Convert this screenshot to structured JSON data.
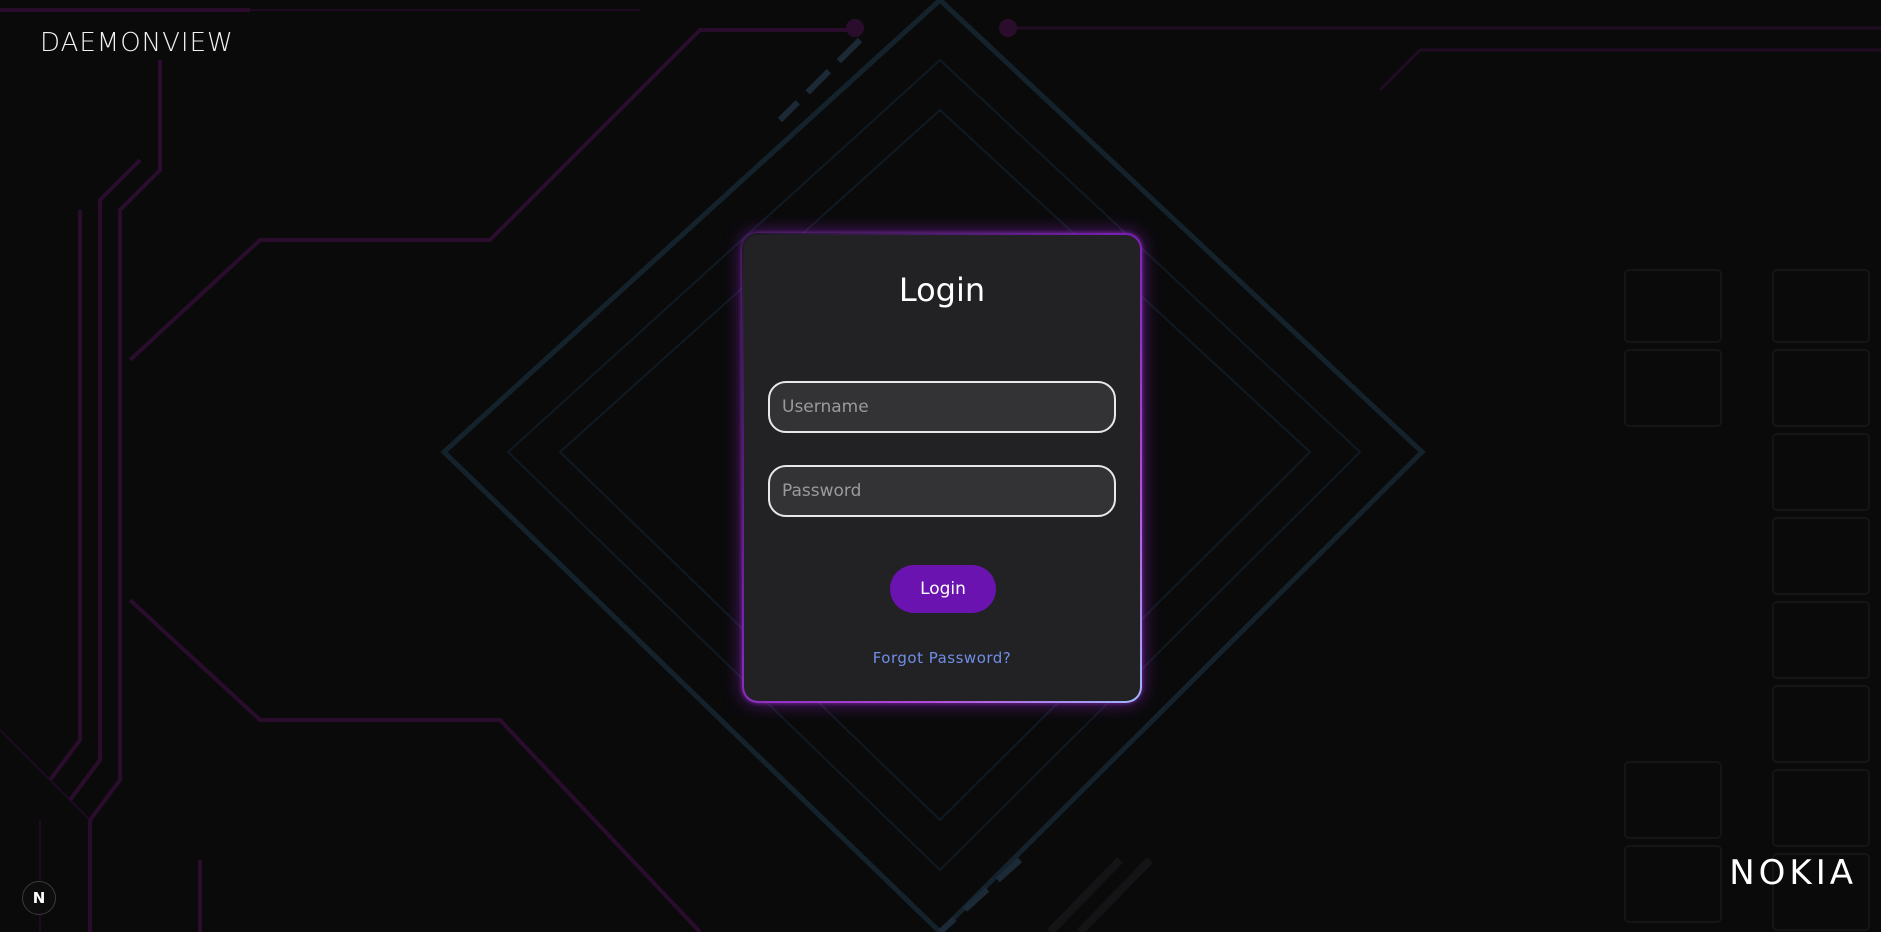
{
  "header": {
    "brand": "DAEMONVIEW"
  },
  "login": {
    "title": "Login",
    "username_placeholder": "Username",
    "password_placeholder": "Password",
    "submit_label": "Login",
    "forgot_label": "Forgot Password?"
  },
  "footer": {
    "vendor_logo": "NOKIA",
    "framework_badge": "N"
  },
  "theme": {
    "background": "#0a0a0b",
    "card": "#222224",
    "accent": "#6a13b0",
    "link": "#6f8ee6",
    "glow": "#b54ad8"
  },
  "icons": {
    "framework_badge": "nextjs-icon"
  }
}
